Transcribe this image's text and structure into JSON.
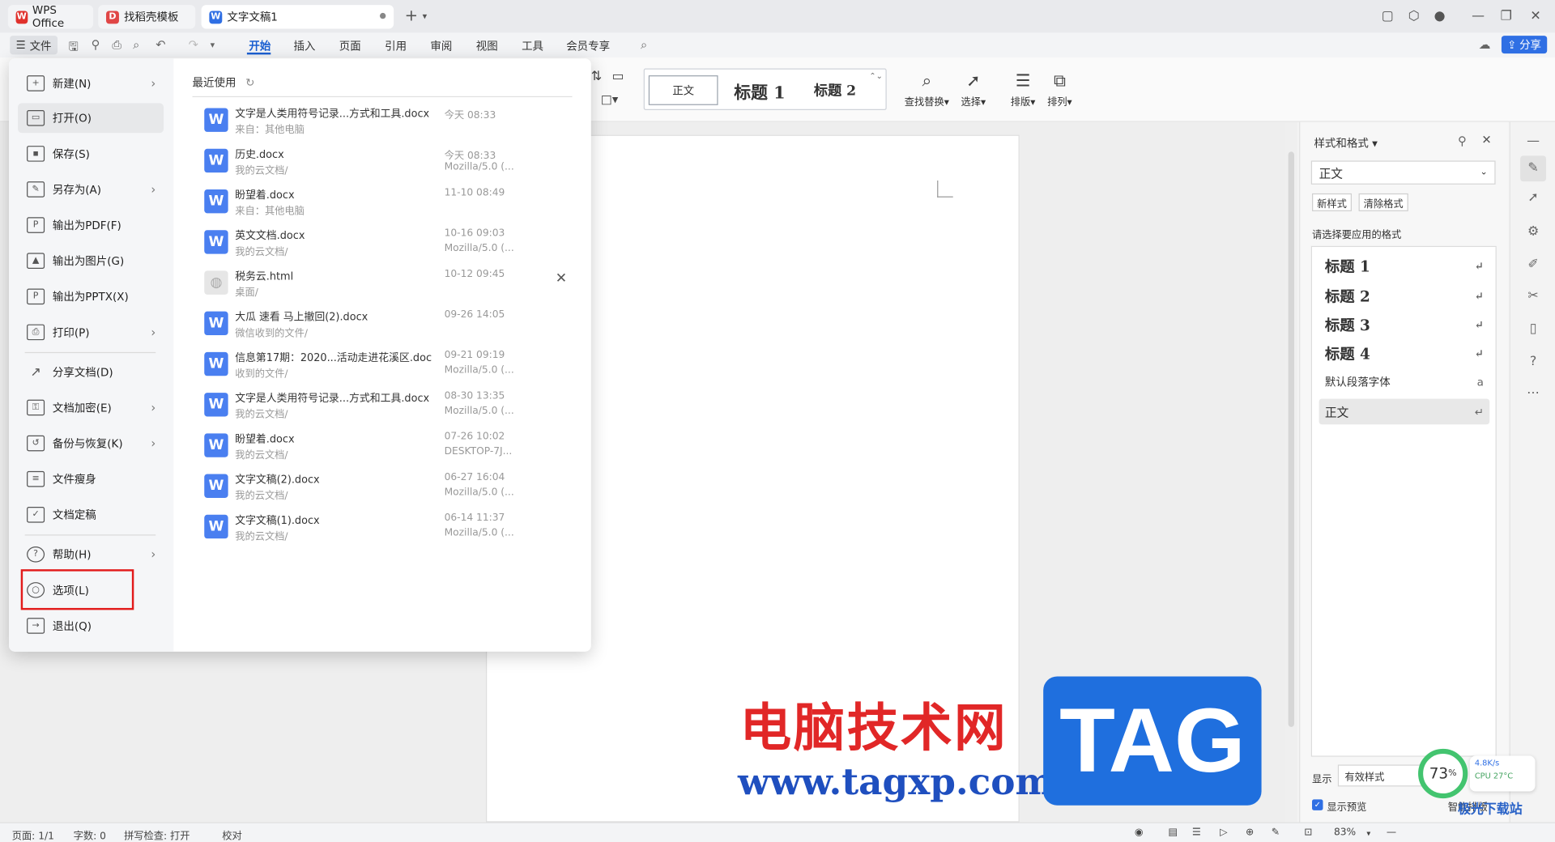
{
  "window": {
    "tabs": [
      {
        "label": "WPS Office"
      },
      {
        "label": "找稻壳模板"
      },
      {
        "label": "文字文稿1"
      }
    ],
    "share_label": "分享"
  },
  "menubar": {
    "file_label": "文件",
    "items": [
      "开始",
      "插入",
      "页面",
      "引用",
      "审阅",
      "视图",
      "工具",
      "会员专享"
    ]
  },
  "ribbon": {
    "styles": [
      "正文",
      "标题 1",
      "标题 2"
    ],
    "tools": [
      "查找替换",
      "选择",
      "排版",
      "排列"
    ]
  },
  "file_menu": {
    "items": [
      {
        "label": "新建(N)",
        "has_arrow": true
      },
      {
        "label": "打开(O)",
        "has_arrow": false
      },
      {
        "label": "保存(S)",
        "has_arrow": false
      },
      {
        "label": "另存为(A)",
        "has_arrow": true
      },
      {
        "label": "输出为PDF(F)",
        "has_arrow": false
      },
      {
        "label": "输出为图片(G)",
        "has_arrow": false
      },
      {
        "label": "输出为PPTX(X)",
        "has_arrow": false
      },
      {
        "label": "打印(P)",
        "has_arrow": true
      },
      {
        "label": "分享文档(D)",
        "has_arrow": false
      },
      {
        "label": "文档加密(E)",
        "has_arrow": true
      },
      {
        "label": "备份与恢复(K)",
        "has_arrow": true
      },
      {
        "label": "文件瘦身",
        "has_arrow": false
      },
      {
        "label": "文档定稿",
        "has_arrow": false
      },
      {
        "label": "帮助(H)",
        "has_arrow": true
      },
      {
        "label": "选项(L)",
        "has_arrow": false
      },
      {
        "label": "退出(Q)",
        "has_arrow": false
      }
    ],
    "recent_title": "最近使用",
    "recent": [
      {
        "name": "文字是人类用符号记录...方式和工具.docx",
        "path": "来自：其他电脑",
        "time": "今天 08:33",
        "source": ""
      },
      {
        "name": "历史.docx",
        "path": "我的云文档/",
        "time": "今天 08:33",
        "source": "Mozilla/5.0 (..."
      },
      {
        "name": "盼望着.docx",
        "path": "来自：其他电脑",
        "time": "11-10 08:49",
        "source": ""
      },
      {
        "name": "英文文档.docx",
        "path": "我的云文档/",
        "time": "10-16 09:03",
        "source": "Mozilla/5.0 (..."
      },
      {
        "name": "税务云.html",
        "path": "桌面/",
        "time": "10-12 09:45",
        "source": ""
      },
      {
        "name": "大瓜 速看 马上撤回(2).docx",
        "path": "微信收到的文件/",
        "time": "09-26 14:05",
        "source": ""
      },
      {
        "name": "信息第17期：2020...活动走进花溪区.doc",
        "path": "收到的文件/",
        "time": "09-21 09:19",
        "source": "Mozilla/5.0 (..."
      },
      {
        "name": "文字是人类用符号记录...方式和工具.docx",
        "path": "我的云文档/",
        "time": "08-30 13:35",
        "source": "Mozilla/5.0 (..."
      },
      {
        "name": "盼望着.docx",
        "path": "我的云文档/",
        "time": "07-26 10:02",
        "source": "DESKTOP-7J..."
      },
      {
        "name": "文字文稿(2).docx",
        "path": "我的云文档/",
        "time": "06-27 16:04",
        "source": "Mozilla/5.0 (..."
      },
      {
        "name": "文字文稿(1).docx",
        "path": "我的云文档/",
        "time": "06-14 11:37",
        "source": "Mozilla/5.0 (..."
      }
    ]
  },
  "styles_panel": {
    "title": "样式和格式",
    "current_style": "正文",
    "new_style_btn": "新样式",
    "clear_format_btn": "清除格式",
    "hint": "请选择要应用的格式",
    "styles": [
      "标题 1",
      "标题 2",
      "标题 3",
      "标题 4",
      "默认段落字体",
      "正文"
    ],
    "show_label": "显示",
    "show_value": "有效样式",
    "preview_label": "显示预览",
    "smart_layout": "智能排版"
  },
  "statusbar": {
    "page": "页面: 1/1",
    "words": "字数: 0",
    "spell": "拼写检查: 打开",
    "proof": "校对",
    "zoom": "83%"
  },
  "monitor": {
    "percent": "73",
    "net": "4.8K/s",
    "cpu": "CPU 27°C"
  },
  "watermark": {
    "cn": "电脑技术网",
    "url": "www.tagxp.com",
    "tag": "TAG",
    "site": "极光下载站"
  }
}
